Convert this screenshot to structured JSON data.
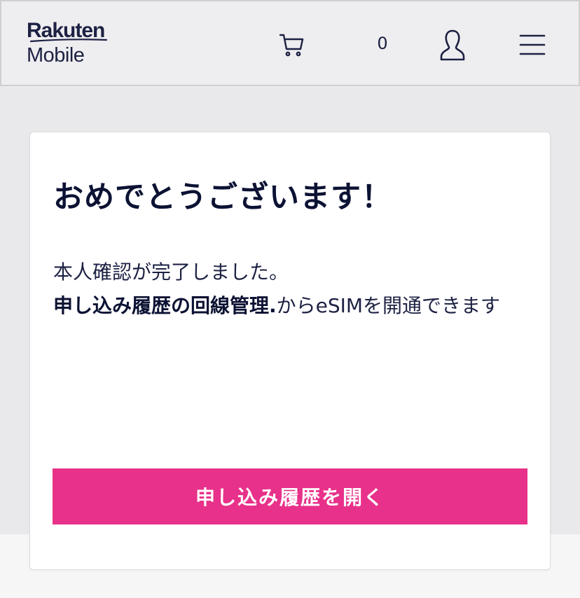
{
  "header": {
    "logo_brand": "Rakuten",
    "logo_product": "Mobile",
    "cart_count": "0",
    "icons": {
      "cart": "cart-icon",
      "user": "user-icon",
      "menu": "hamburger-menu-icon"
    }
  },
  "card": {
    "title": "おめでとうございます！",
    "line1": "本人確認が完了しました。",
    "link_text": "申し込み履歴の回線管理.",
    "line2_rest": "からeSIMを開通できます",
    "button_label": "申し込み履歴を開く"
  },
  "colors": {
    "accent": "#e8318a",
    "text": "#0c1233",
    "background": "#e9e9ec"
  }
}
